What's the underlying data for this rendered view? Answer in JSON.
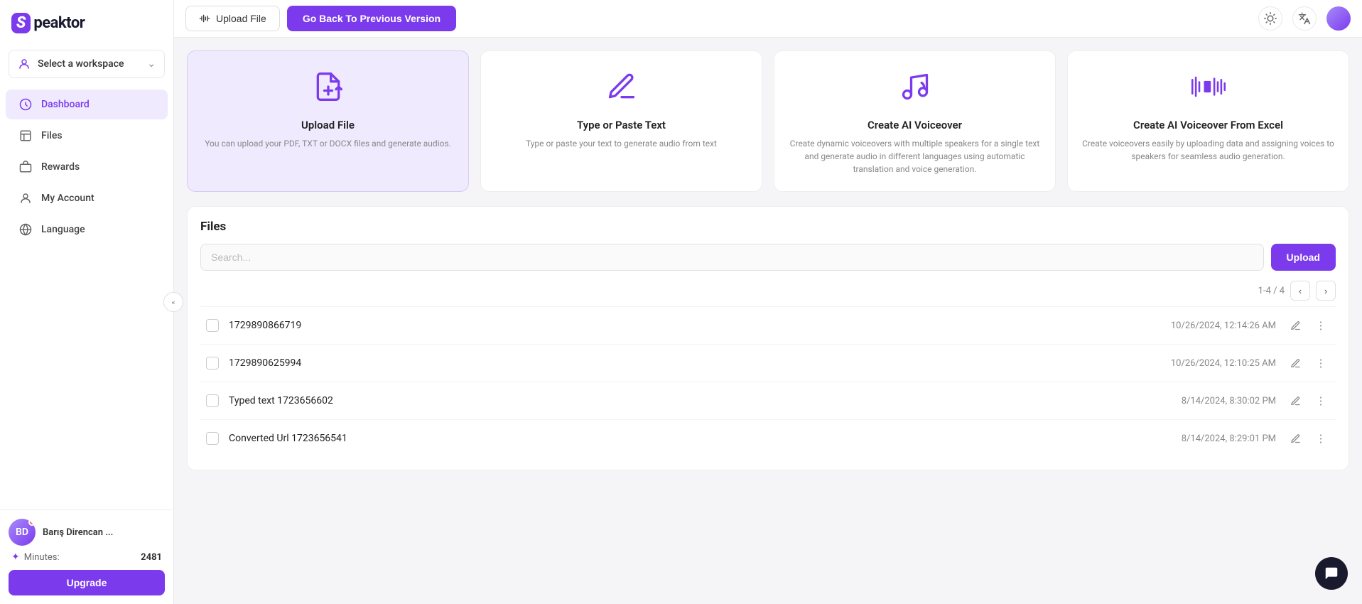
{
  "logo": {
    "s_letter": "S",
    "app_name": "peaktor"
  },
  "sidebar": {
    "workspace_label": "Select a workspace",
    "nav_items": [
      {
        "id": "dashboard",
        "label": "Dashboard",
        "active": true
      },
      {
        "id": "files",
        "label": "Files",
        "active": false
      },
      {
        "id": "rewards",
        "label": "Rewards",
        "active": false
      },
      {
        "id": "my-account",
        "label": "My Account",
        "active": false
      },
      {
        "id": "language",
        "label": "Language",
        "active": false
      }
    ],
    "user": {
      "name": "Barış Direncan ...",
      "minutes_label": "Minutes:",
      "minutes_value": "2481"
    },
    "upgrade_label": "Upgrade"
  },
  "topbar": {
    "upload_file_label": "Upload File",
    "go_back_label": "Go Back To Previous Version"
  },
  "cards": [
    {
      "id": "upload-file",
      "title": "Upload File",
      "desc": "You can upload your PDF, TXT or DOCX files and generate audios.",
      "highlight": true
    },
    {
      "id": "type-paste",
      "title": "Type or Paste Text",
      "desc": "Type or paste your text to generate audio from text",
      "highlight": false
    },
    {
      "id": "ai-voiceover",
      "title": "Create AI Voiceover",
      "desc": "Create dynamic voiceovers with multiple speakers for a single text and generate audio in different languages using automatic translation and voice generation.",
      "highlight": false
    },
    {
      "id": "ai-voiceover-excel",
      "title": "Create AI Voiceover From Excel",
      "desc": "Create voiceovers easily by uploading data and assigning voices to speakers for seamless audio generation.",
      "highlight": false
    }
  ],
  "files_section": {
    "title": "Files",
    "search_placeholder": "Search...",
    "upload_label": "Upload",
    "pagination": "1-4 / 4",
    "files": [
      {
        "id": 1,
        "name": "1729890866719",
        "date": "10/26/2024, 12:14:26 AM"
      },
      {
        "id": 2,
        "name": "1729890625994",
        "date": "10/26/2024, 12:10:25 AM"
      },
      {
        "id": 3,
        "name": "Typed text 1723656602",
        "date": "8/14/2024, 8:30:02 PM"
      },
      {
        "id": 4,
        "name": "Converted Url 1723656541",
        "date": "8/14/2024, 8:29:01 PM"
      }
    ]
  }
}
